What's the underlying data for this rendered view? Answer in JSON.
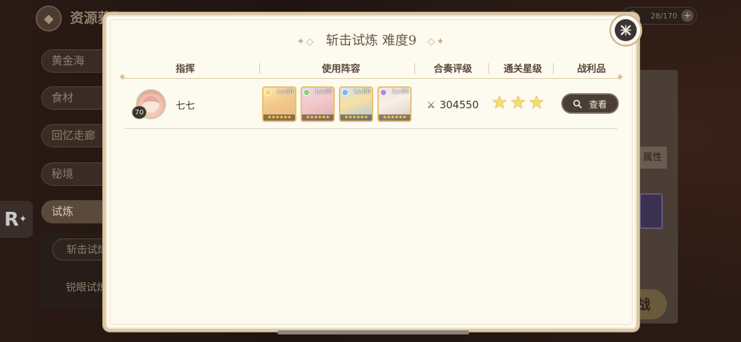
{
  "background": {
    "header_title": "资源获取",
    "resource_counter": "28/170",
    "side_tabs": [
      "黄金海",
      "食材",
      "回忆走廊",
      "秘境",
      "试炼"
    ],
    "sub_tabs": [
      "斩击试炼",
      "锐眼试炼"
    ],
    "right_label": "属性",
    "right_button": "战"
  },
  "modal": {
    "title": "斩击试炼 难度9",
    "title_ornament": "✦◇",
    "headers": {
      "commander": "指挥",
      "lineup": "使用阵容",
      "rating": "合奏评级",
      "clear_stars": "通关星级",
      "loot": "战利品"
    },
    "rows": [
      {
        "level": "70",
        "name": "七七",
        "heroes": [
          {
            "level": "Lv.80",
            "stars": "★★★★★★"
          },
          {
            "level": "Lv.80",
            "stars": "★★★★★★"
          },
          {
            "level": "Lv.80",
            "stars": "★★★★★★"
          },
          {
            "level": "Lv.80",
            "stars": "★★★★★★"
          }
        ],
        "score": "304550",
        "stars": 3,
        "view_label": "查看"
      }
    ]
  },
  "icons": {
    "close": "close-x-icon",
    "score": "crossed-swords-icon",
    "search": "magnifier-icon",
    "star": "star-icon"
  },
  "colors": {
    "panel_bg": "#fdfaf0",
    "border_gold": "#d9c7a6",
    "button_dark": "#4a3f36",
    "star_gold": "#f6dd6e"
  }
}
